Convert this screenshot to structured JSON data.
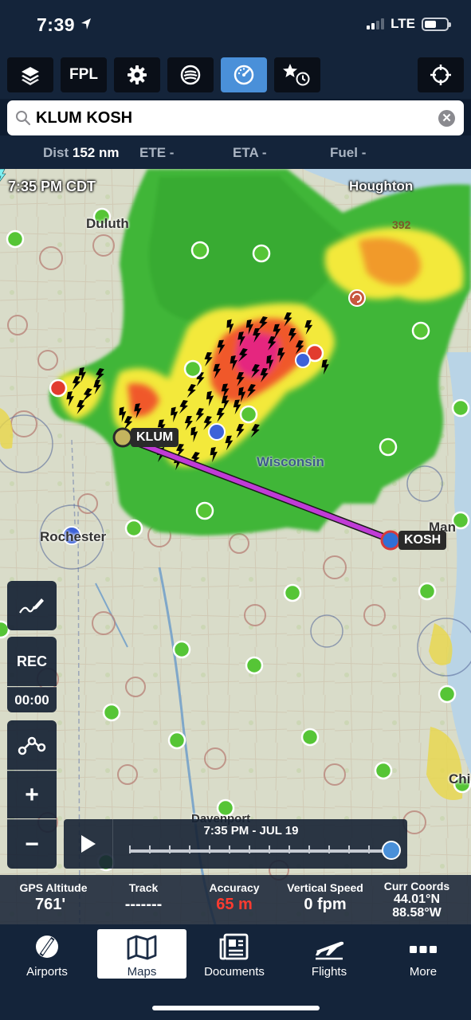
{
  "status_bar": {
    "time": "7:39",
    "network": "LTE",
    "battery_level": 0.55
  },
  "toolbar": {
    "layers_icon": "layers-icon",
    "fpl_label": "FPL",
    "settings_icon": "gear-icon",
    "weather_icon": "weather-icon",
    "gauge_icon": "gauge-icon",
    "favorites_icon": "star-clock-icon",
    "center_icon": "crosshair-icon",
    "active_tool": "gauge"
  },
  "search": {
    "value": "KLUM KOSH",
    "clear_icon": "clear-icon"
  },
  "route": {
    "dist_label": "Dist",
    "dist_value": "152 nm",
    "ete_label": "ETE",
    "ete_value": "-",
    "eta_label": "ETA",
    "eta_value": "-",
    "fuel_label": "Fuel",
    "fuel_value": "-"
  },
  "map": {
    "timestamp": "7:35 PM CDT",
    "places": {
      "houghton": "Houghton",
      "duluth": "Duluth",
      "wisconsin": "Wisconsin",
      "rochester": "Rochester",
      "davenport": "Davenport",
      "manitowoc": "Man",
      "chicago": "Chi",
      "altitude_mark": "392"
    },
    "departure": "KLUM",
    "destination": "KOSH",
    "route_color": "#c03bd6"
  },
  "side_controls": {
    "draw_icon": "pencil-icon",
    "rec_label": "REC",
    "rec_timer": "00:00",
    "route_edit_icon": "route-icon",
    "zoom_in": "+",
    "zoom_out": "−"
  },
  "timeline": {
    "label": "7:35 PM - JUL 19",
    "position": 1.0
  },
  "instruments": {
    "gps_altitude_label": "GPS Altitude",
    "gps_altitude_value": "761'",
    "track_label": "Track",
    "track_value": "-------",
    "accuracy_label": "Accuracy",
    "accuracy_value": "65 m",
    "vertical_speed_label": "Vertical Speed",
    "vertical_speed_value": "0 fpm",
    "coords_label": "Curr Coords",
    "coords_lat": "44.01°N",
    "coords_lon": "88.58°W"
  },
  "tabs": [
    {
      "label": "Airports",
      "icon": "airports-icon"
    },
    {
      "label": "Maps",
      "icon": "map-icon",
      "active": true
    },
    {
      "label": "Documents",
      "icon": "documents-icon"
    },
    {
      "label": "Flights",
      "icon": "plane-icon"
    },
    {
      "label": "More",
      "icon": "more-icon"
    }
  ],
  "colors": {
    "accent": "#4a90d9",
    "bar_bg": "#14243a",
    "alert_red": "#ff3b30"
  }
}
